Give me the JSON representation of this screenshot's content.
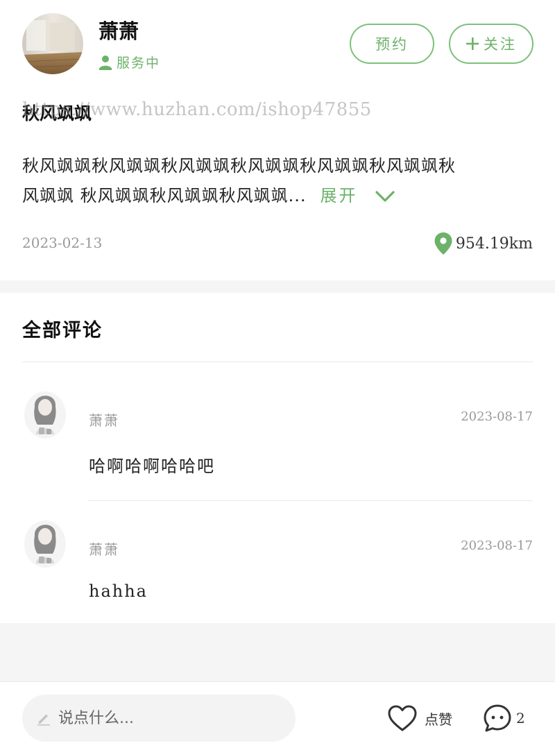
{
  "profile": {
    "name": "萧萧",
    "status": "服务中",
    "book_label": "预约",
    "follow_label": "关注"
  },
  "post": {
    "title": "秋风飒飒",
    "watermark": "https://www.huzhan.com/ishop47855",
    "body_line1": "秋风飒飒秋风飒飒秋风飒飒秋风飒飒秋风飒飒秋风飒飒秋",
    "body_line2": "风飒飒 秋风飒飒秋风飒飒秋风飒飒...",
    "expand_label": "展开",
    "date": "2023-02-13",
    "distance": "954.19km"
  },
  "comments": {
    "title": "全部评论",
    "items": [
      {
        "name": "萧萧",
        "date": "2023-08-17",
        "text": "哈啊哈啊哈哈吧"
      },
      {
        "name": "萧萧",
        "date": "2023-08-17",
        "text": "hahha"
      }
    ]
  },
  "bottom_bar": {
    "input_placeholder": "说点什么...",
    "like_label": "点赞",
    "comment_count": "2"
  },
  "colors": {
    "accent": "#6cb26a",
    "muted_text": "#999999",
    "page_bg": "#f5f5f5"
  },
  "icons": {
    "status": "person-icon",
    "follow": "plus-icon",
    "expand": "chevron-down-icon",
    "location": "location-pin-icon",
    "input": "pencil-icon",
    "like": "heart-icon",
    "comment": "chat-bubble-icon"
  }
}
